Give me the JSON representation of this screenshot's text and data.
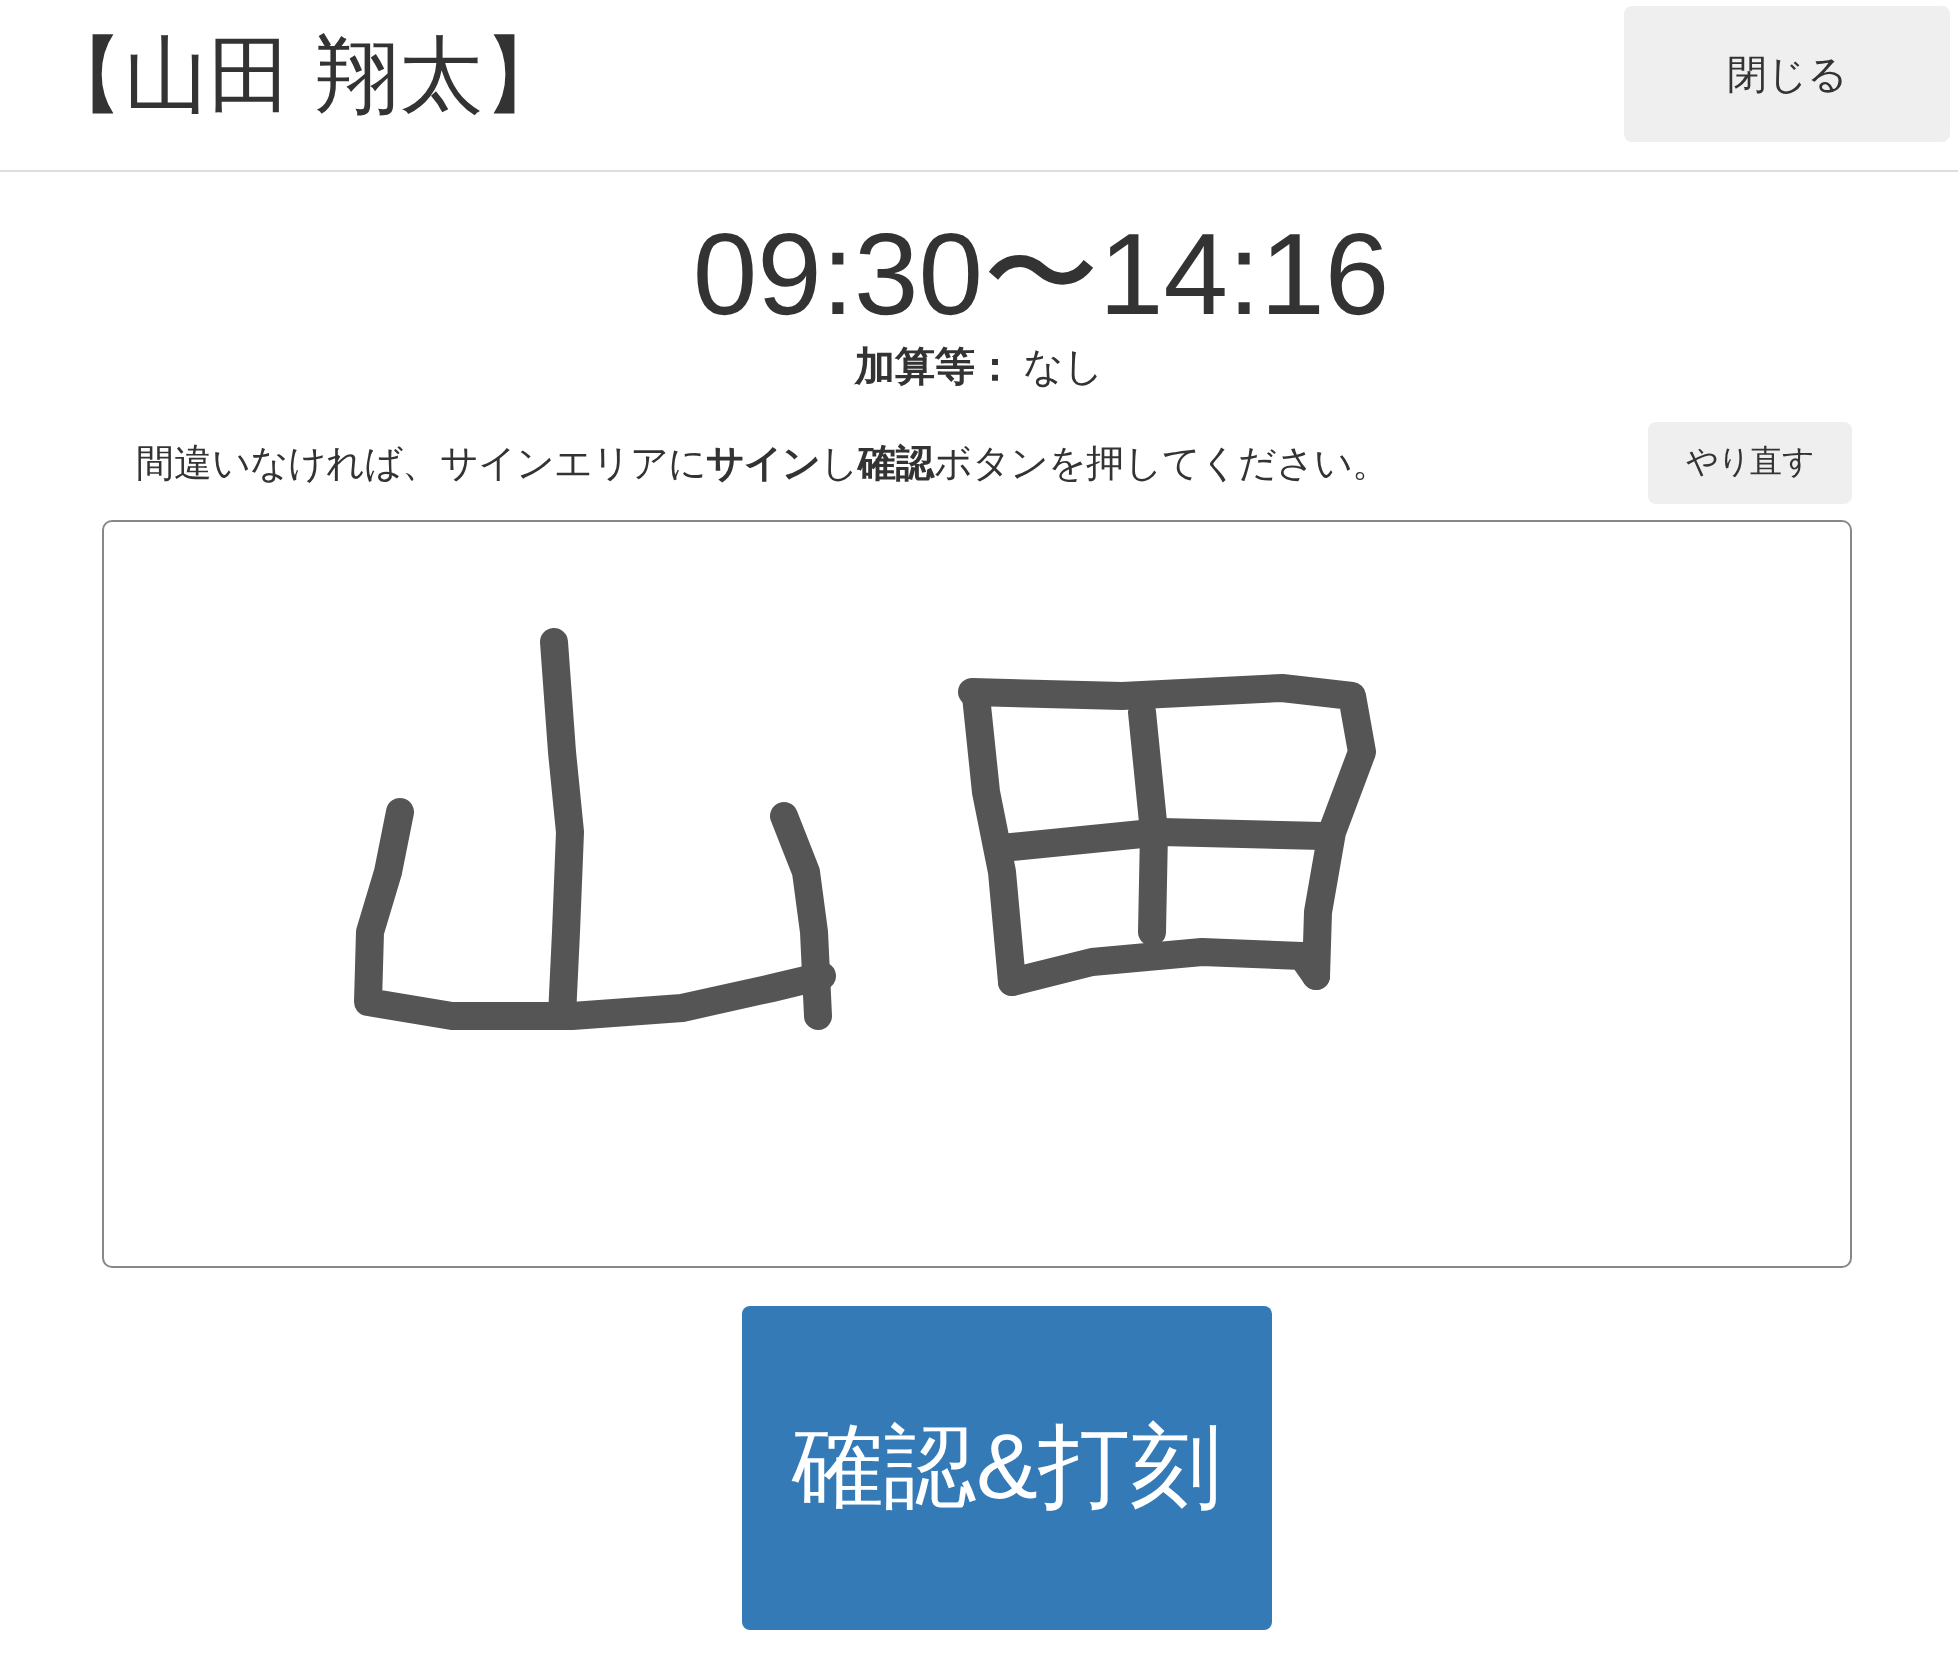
{
  "header": {
    "title": "【山田 翔太】",
    "close_button": "閉じる"
  },
  "time_range": "09:30〜14:16",
  "addition": {
    "label": "加算等：",
    "value": "なし"
  },
  "instruction": "間違いなければ、サインエリアに**サイン**し**確認**ボタンを押してください。",
  "redo_button": "やり直す",
  "confirm_button": "確認&打刻"
}
